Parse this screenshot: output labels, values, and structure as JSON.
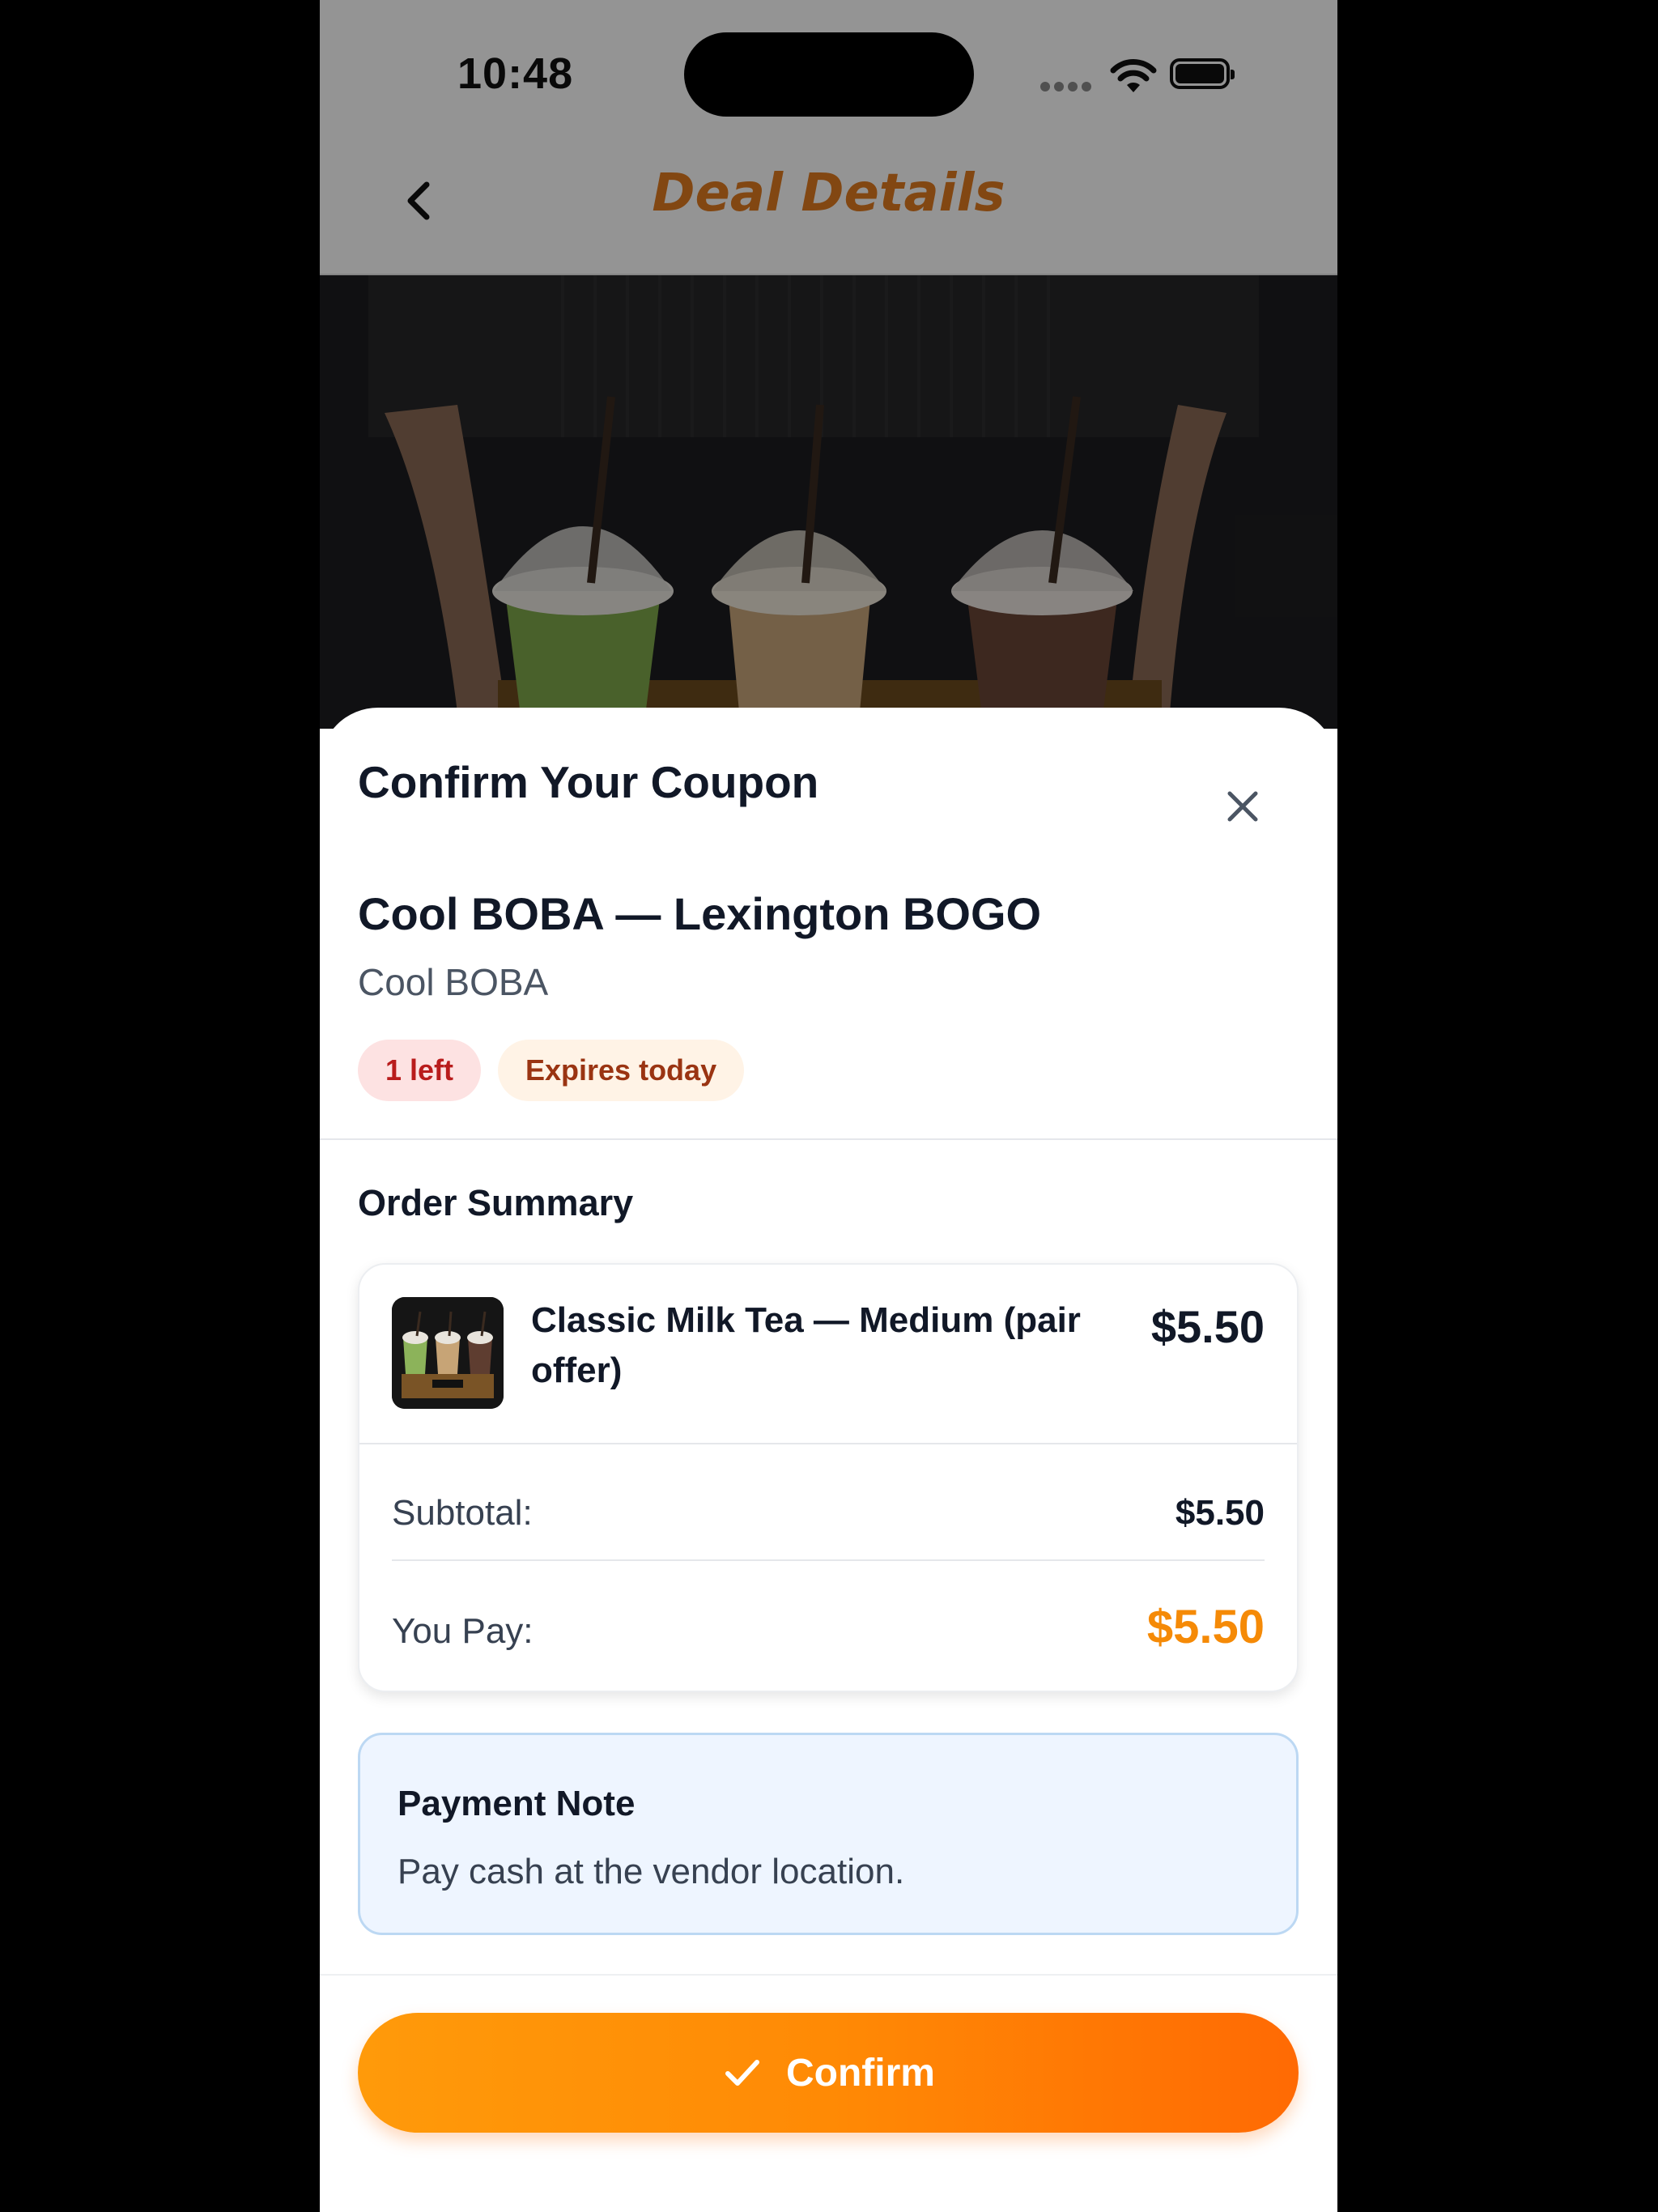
{
  "status_bar": {
    "time": "10:48"
  },
  "nav": {
    "title": "Deal Details"
  },
  "sheet": {
    "title": "Confirm Your Coupon",
    "deal_title": "Cool BOBA — Lexington BOGO",
    "vendor": "Cool BOBA",
    "badges": {
      "left": "1 left",
      "expires": "Expires today"
    },
    "order_summary": {
      "title": "Order Summary",
      "item_name": "Classic Milk Tea — Medium (pair offer)",
      "item_price": "$5.50",
      "subtotal_label": "Subtotal:",
      "subtotal_value": "$5.50",
      "you_pay_label": "You Pay:",
      "you_pay_value": "$5.50"
    },
    "payment_note": {
      "title": "Payment Note",
      "text": "Pay cash at the vendor location."
    },
    "confirm_label": "Confirm"
  },
  "colors": {
    "accent": "#ff8a05",
    "pay_value": "#f58a07",
    "nav_title": "#e07a1f",
    "badge_left_bg": "#fde2e2",
    "badge_expires_bg": "#fff3e6",
    "note_bg": "#eef5ff"
  },
  "icons": {
    "back": "chevron-left-icon",
    "close": "close-icon",
    "confirm": "checkmark-icon",
    "wifi": "wifi-icon",
    "battery": "battery-icon"
  }
}
